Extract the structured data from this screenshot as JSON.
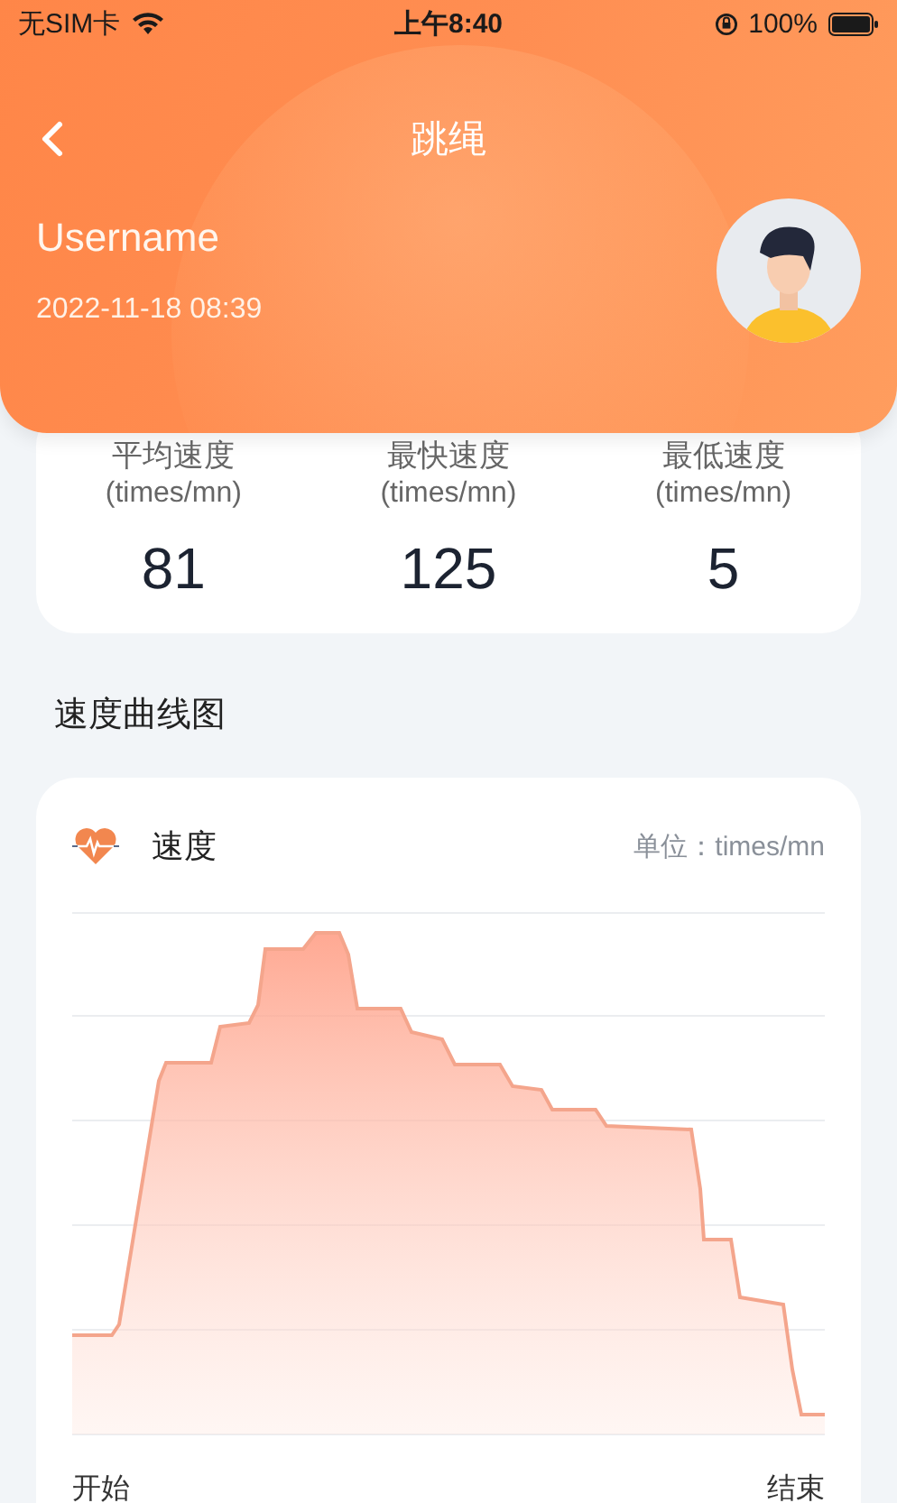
{
  "status_bar": {
    "carrier": "无SIM卡",
    "time": "上午8:40",
    "battery": "100%"
  },
  "header": {
    "title": "跳绳",
    "username": "Username",
    "datetime": "2022-11-18 08:39"
  },
  "stats": [
    {
      "label": "平均速度",
      "unit": "(times/mn)",
      "value": "81"
    },
    {
      "label": "最快速度",
      "unit": "(times/mn)",
      "value": "125"
    },
    {
      "label": "最低速度",
      "unit": "(times/mn)",
      "value": "5"
    }
  ],
  "section_title": "速度曲线图",
  "chart": {
    "title": "速度",
    "unit": "单位：times/mn",
    "start_label": "开始",
    "end_label": "结束"
  }
}
